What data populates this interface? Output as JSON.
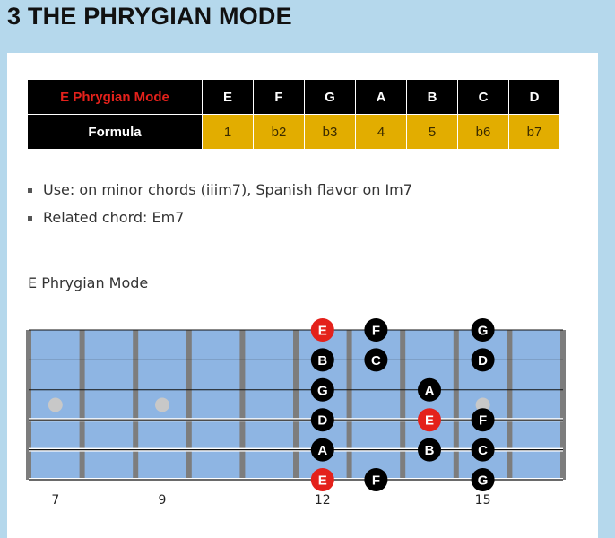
{
  "heading": "3 THE PHRYGIAN MODE",
  "table": {
    "row1_label": "E Phrygian Mode",
    "notes": [
      "E",
      "F",
      "G",
      "A",
      "B",
      "C",
      "D"
    ],
    "row2_label": "Formula",
    "formula": [
      "1",
      "b2",
      "b3",
      "4",
      "5",
      "b6",
      "b7"
    ]
  },
  "notes_list": [
    "Use: on minor chords (iiim7), Spanish flavor on Im7",
    "Related chord: Em7"
  ],
  "fretboard": {
    "title": "E Phrygian Mode",
    "first_fret": 7,
    "last_fret": 16,
    "fret_numbers": [
      "7",
      "9",
      "12",
      "15"
    ],
    "inlay_frets": [
      7,
      9,
      15
    ],
    "colors": {
      "board": "#8eb5e3",
      "fret": "#7d7d7d",
      "dot_black": "#000000",
      "dot_root": "#e4211b",
      "inlay": "#c8c8c8"
    },
    "dots": [
      {
        "string": 1,
        "fret": 12,
        "label": "E",
        "root": true
      },
      {
        "string": 1,
        "fret": 13,
        "label": "F",
        "root": false
      },
      {
        "string": 1,
        "fret": 15,
        "label": "G",
        "root": false
      },
      {
        "string": 2,
        "fret": 12,
        "label": "B",
        "root": false
      },
      {
        "string": 2,
        "fret": 13,
        "label": "C",
        "root": false
      },
      {
        "string": 2,
        "fret": 15,
        "label": "D",
        "root": false
      },
      {
        "string": 3,
        "fret": 12,
        "label": "G",
        "root": false
      },
      {
        "string": 3,
        "fret": 14,
        "label": "A",
        "root": false
      },
      {
        "string": 4,
        "fret": 12,
        "label": "D",
        "root": false
      },
      {
        "string": 4,
        "fret": 14,
        "label": "E",
        "root": true
      },
      {
        "string": 4,
        "fret": 15,
        "label": "F",
        "root": false
      },
      {
        "string": 5,
        "fret": 12,
        "label": "A",
        "root": false
      },
      {
        "string": 5,
        "fret": 14,
        "label": "B",
        "root": false
      },
      {
        "string": 5,
        "fret": 15,
        "label": "C",
        "root": false
      },
      {
        "string": 6,
        "fret": 12,
        "label": "E",
        "root": true
      },
      {
        "string": 6,
        "fret": 13,
        "label": "F",
        "root": false
      },
      {
        "string": 6,
        "fret": 15,
        "label": "G",
        "root": false
      }
    ]
  }
}
